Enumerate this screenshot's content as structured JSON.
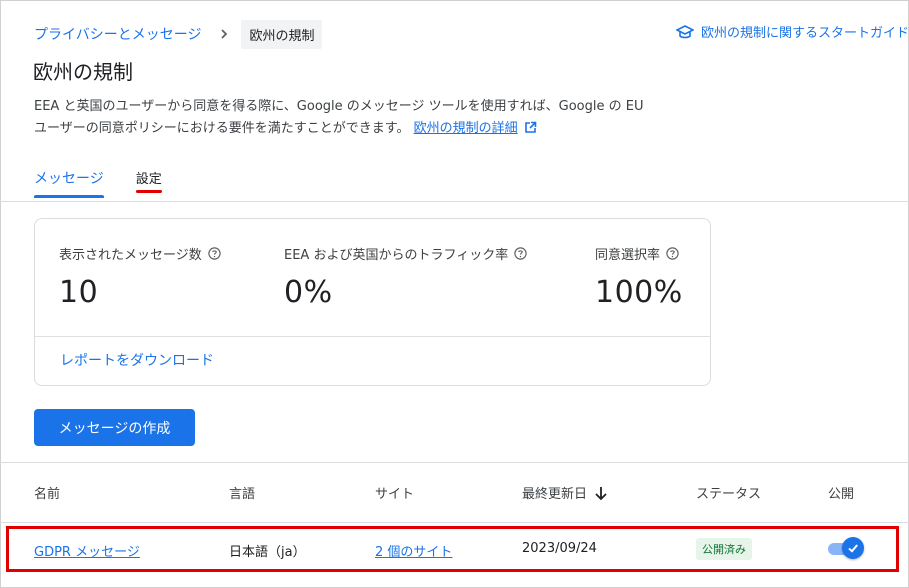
{
  "breadcrumb": {
    "parent": "プライバシーとメッセージ",
    "current": "欧州の規制"
  },
  "guide": {
    "label": "欧州の規制に関するスタートガイド"
  },
  "page": {
    "title": "欧州の規制",
    "description": "EEA と英国のユーザーから同意を得る際に、Google のメッセージ ツールを使用すれば、Google の EU ユーザーの同意ポリシーにおける要件を満たすことができます。",
    "details_link": "欧州の規制の詳細"
  },
  "tabs": [
    {
      "label": "メッセージ"
    },
    {
      "label": "設定"
    }
  ],
  "stats": [
    {
      "label": "表示されたメッセージ数",
      "value": "10"
    },
    {
      "label": "EEA および英国からのトラフィック率",
      "value": "0%"
    },
    {
      "label": "同意選択率",
      "value": "100%"
    }
  ],
  "card": {
    "download_label": "レポートをダウンロード"
  },
  "create_button": {
    "label": "メッセージの作成"
  },
  "table": {
    "columns": [
      "名前",
      "言語",
      "サイト",
      "最終更新日",
      "ステータス",
      "公開"
    ],
    "rows": [
      {
        "name": "GDPR メッセージ",
        "language": "日本語（ja）",
        "sites": "2 個のサイト",
        "updated": "2023/09/24",
        "status": "公開済み",
        "published": true
      }
    ]
  },
  "colors": {
    "accent": "#1a73e8",
    "highlight": "#e00000",
    "status_bg": "#e6f4ea",
    "status_text": "#137333"
  }
}
